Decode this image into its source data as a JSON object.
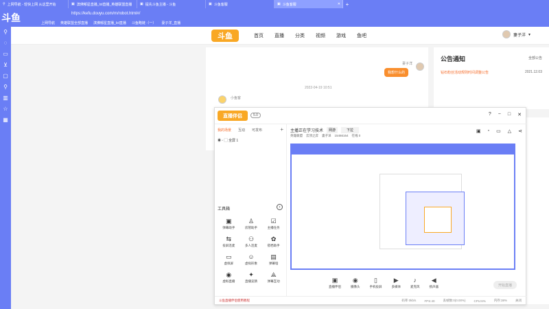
{
  "browser": {
    "tabs": [
      {
        "title": "上网导航 - 轻快上网 从这里开始"
      },
      {
        "title": "滨佛郁星直播_lol直播_英雄联盟直播"
      },
      {
        "title": "提先斗鱼主播 - 斗鱼"
      },
      {
        "title": "斗鱼客服"
      },
      {
        "title": "斗鱼客服"
      }
    ],
    "url": "https://kefu.douyu.com/m/robot.html#/",
    "bookmarks": [
      "上网导航",
      "英雄联盟全部直播",
      "滨佛郁星直播_lol直播",
      "斗鱼略链 ·（一）",
      "妻子洋_直播"
    ],
    "sidebar_brand": "斗鱼"
  },
  "site": {
    "logo_text": "斗鱼",
    "nav": [
      "首页",
      "直播",
      "分类",
      "视频",
      "游戏",
      "鱼吧"
    ],
    "user_name": "妻子洋"
  },
  "chat": {
    "sender_label": "妻子洋",
    "outgoing_message": "我想什么的",
    "timestamp": "2022-04-19 10:51",
    "reply_sender": "小鱼客"
  },
  "notice": {
    "title": "公告通知",
    "more": "全部公告",
    "item_text": "钻石粉丝活动规则时间调整公告",
    "item_date": "2021.12.03"
  },
  "obs": {
    "logo": "直播伴侣",
    "badge": "5.0",
    "window_controls": [
      "?",
      "−",
      "□",
      "✕"
    ],
    "scene_tabs": [
      "我的场景",
      "互动",
      "可发布"
    ],
    "scene_item": "全屏 1",
    "tools_title": "工具箱",
    "tools": [
      {
        "label": "弹幕助手",
        "icon": "▣"
      },
      {
        "label": "房管助手",
        "icon": "♙"
      },
      {
        "label": "主播任务",
        "icon": "☑"
      },
      {
        "label": "投屏连麦",
        "icon": "⇆"
      },
      {
        "label": "多人连麦",
        "icon": "⚇"
      },
      {
        "label": "搭档助手",
        "icon": "✿"
      },
      {
        "label": "虚拟屏",
        "icon": "▭"
      },
      {
        "label": "虚拟形象",
        "icon": "☺"
      },
      {
        "label": "弹幕墙",
        "icon": "▤"
      },
      {
        "label": "虚拟直播",
        "icon": "◉"
      },
      {
        "label": "直播竞猜",
        "icon": "✦"
      },
      {
        "label": "弹幕互动",
        "icon": "⟁"
      }
    ],
    "stream_title": "主播正在学习技术",
    "category": "网游",
    "subcategory": "下拉",
    "stream_info": [
      "英雄联盟",
      "云顶之弈",
      "妻子洋",
      "15466164",
      "在线 0"
    ],
    "bottom_tools": [
      {
        "label": "直播伴侣",
        "icon": "▣"
      },
      {
        "label": "摄像头",
        "icon": "◉"
      },
      {
        "label": "手机投屏",
        "icon": "▯"
      },
      {
        "label": "多媒体",
        "icon": "▶"
      },
      {
        "label": "麦克风",
        "icon": "♪"
      },
      {
        "label": "扬声器",
        "icon": "◀"
      }
    ],
    "go_live": "开始直播",
    "status": {
      "warning": "斗鱼直播伴侣使用教程",
      "items": [
        "码率 0kb/s",
        "FPS:40",
        "丢帧数:0(0.00%)",
        "CPU:6%",
        "内存:38%",
        "关闭"
      ]
    }
  }
}
